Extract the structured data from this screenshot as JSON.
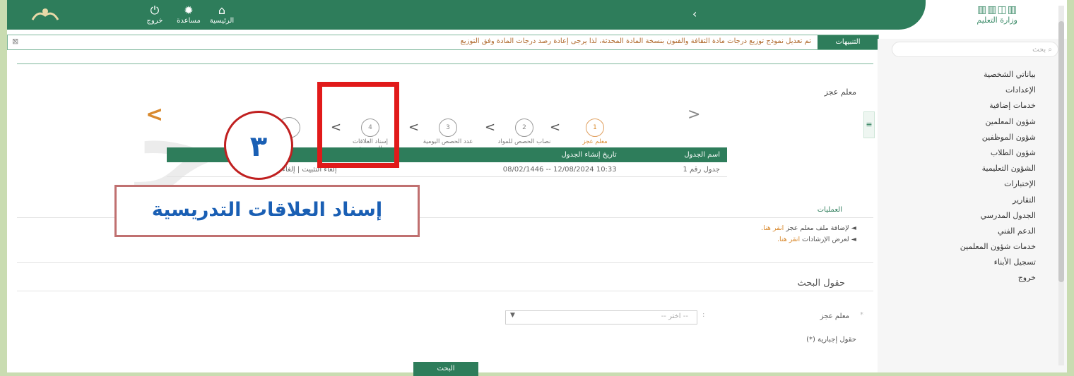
{
  "topbar": {
    "logout": "خروج",
    "help": "مساعدة",
    "home": "الرئيسية",
    "ministry_name": "وزارة التعليم"
  },
  "ticker": {
    "tag": "التنبيهات",
    "text": "تم تعديل نموذج توزيع درجات مادة الثقافة والفنون بنسخة المادة المحدثة، لذا يرجى إعادة رصد درجات المادة وفق التوزيع"
  },
  "sidebar": {
    "search_placeholder": "بحث",
    "items": [
      "بياناتي الشخصية",
      "الإعدادات",
      "خدمات إضافية",
      "شؤون المعلمين",
      "شؤون الموظفين",
      "شؤون الطلاب",
      "الشؤون التعليمية",
      "الإختبارات",
      "التقارير",
      "الجدول المدرسي",
      "الدعم الفني",
      "خدمات شؤون المعلمين",
      "تسجيل الأبناء",
      "خروج"
    ]
  },
  "main": {
    "heading": "معلم عجز",
    "wizard": {
      "steps": [
        {
          "num": "1",
          "label": "معلم عجز"
        },
        {
          "num": "2",
          "label": "نصاب الحصص للمواد"
        },
        {
          "num": "3",
          "label": "عدد الحصص اليومية"
        },
        {
          "num": "4",
          "label": "إسناد العلاقات التدريسية"
        }
      ]
    },
    "table": {
      "headers": [
        "اسم الجدول",
        "تاريخ إنشاء الجدول",
        ""
      ],
      "rows": [
        [
          "جدول رقم 1",
          "10:33 12/08/2024 -- 08/02/1446",
          "إلغاء التثبيت | إلغاء نشر"
        ]
      ]
    },
    "operations": {
      "title": "العمليات",
      "add_text": "◄ لإضافة ملف معلم عجز",
      "add_link": "انقر هنا.",
      "guide_text": "◄ لعرض الإرشادات",
      "guide_link": "انقر هنا."
    },
    "search": {
      "title": "حقول البحث",
      "field_label": "معلم عجز",
      "select_placeholder": "-- اختر --",
      "required_note": "(*) حقول إجبارية",
      "button": "البحث"
    }
  },
  "annotation": {
    "number": "٣",
    "text": "إسناد العلاقات التدريسية"
  }
}
